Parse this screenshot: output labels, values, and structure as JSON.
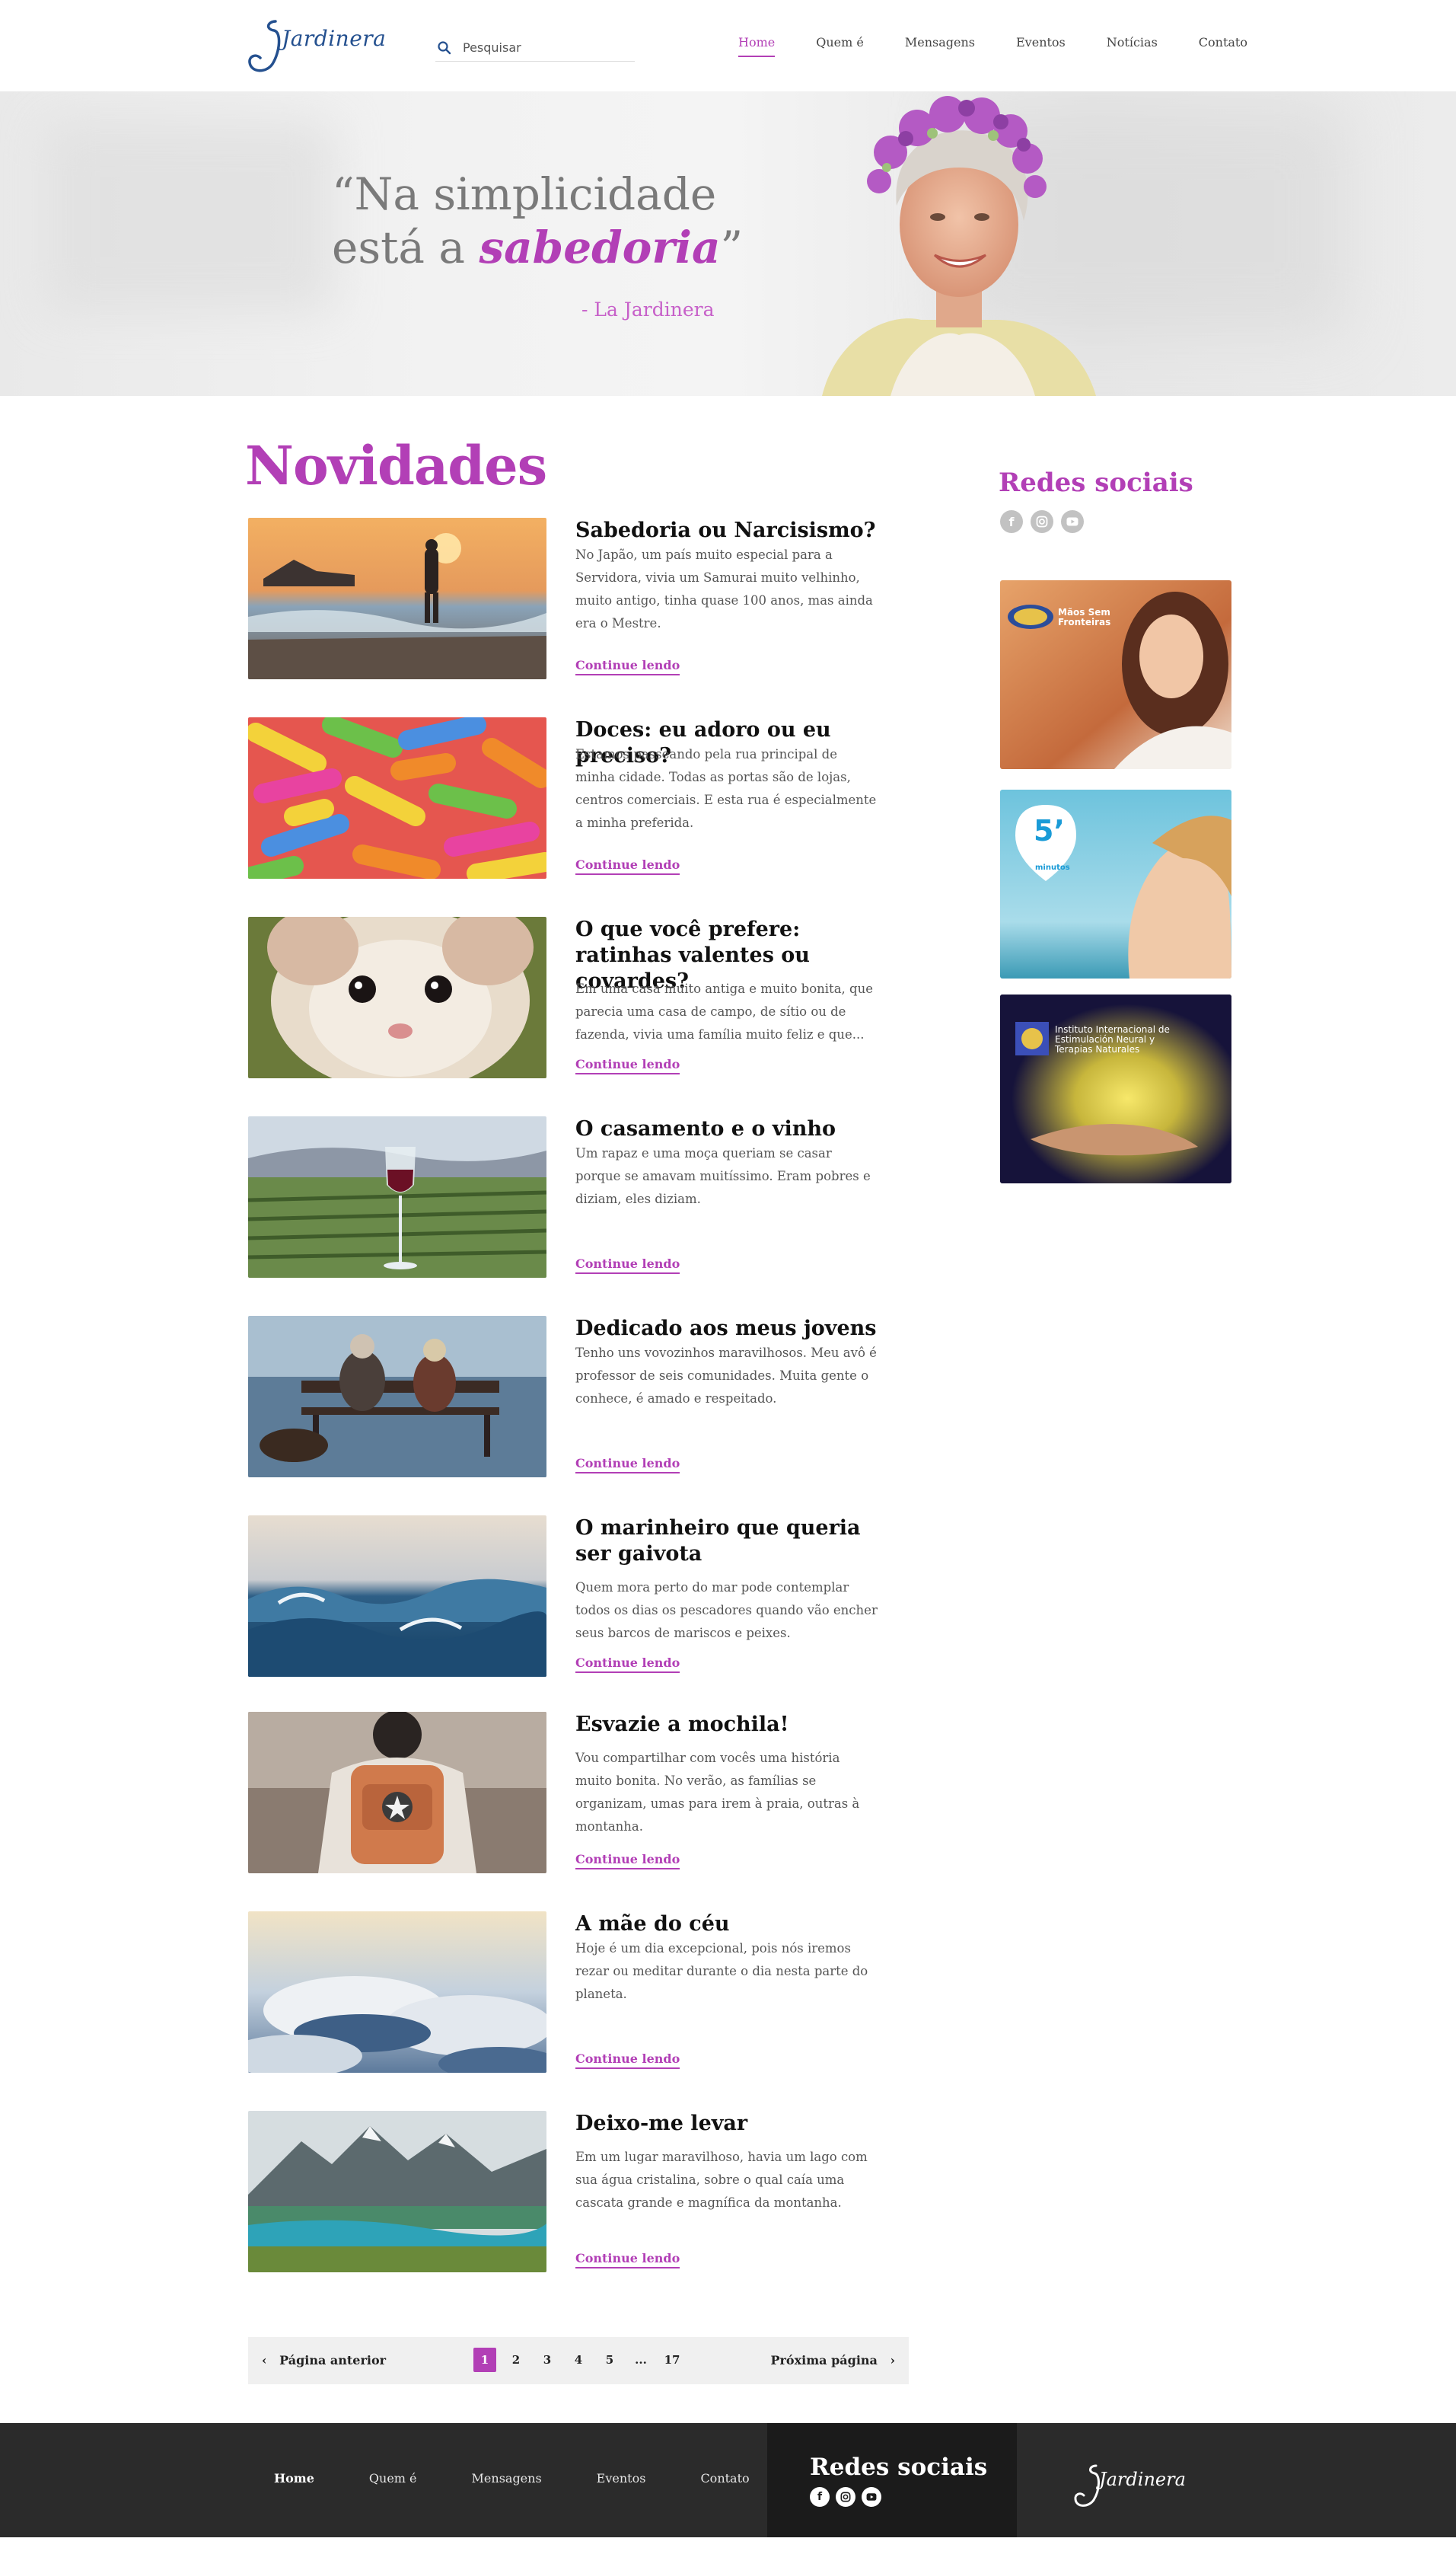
{
  "header": {
    "logo_text": "Jardinera",
    "search_placeholder": "Pesquisar",
    "nav": [
      "Home",
      "Quem é",
      "Mensagens",
      "Eventos",
      "Notícias",
      "Contato"
    ],
    "active_nav": "Home"
  },
  "hero": {
    "quote_line1": "“Na simplicidade",
    "quote_line2_prefix": "está a ",
    "quote_emphasis": "sabedoria",
    "quote_close": "”",
    "author": "- La Jardinera"
  },
  "main": {
    "title": "Novidades",
    "link_label": "Continue lendo",
    "posts": [
      {
        "title": "Sabedoria ou Narcisismo?",
        "excerpt": "No Japão, um país muito especial para a Servidora, vivia um Samurai muito velhinho, muito antigo, tinha quase 100 anos, mas ainda era o Mestre."
      },
      {
        "title": "Doces: eu adoro ou eu preciso?",
        "excerpt": "Estamos passeando pela rua principal de minha cidade. Todas as portas são de lojas, centros comerciais. E esta rua é especialmente a minha preferida."
      },
      {
        "title": "O que você prefere: ratinhas valentes ou covardes?",
        "excerpt": "Em uma casa muito antiga e muito bonita, que parecia uma casa de campo, de sítio ou de fazenda, vivia uma família muito feliz e que..."
      },
      {
        "title": "O casamento e o vinho",
        "excerpt": "Um rapaz e uma moça queriam se casar porque se amavam muitíssimo. Eram pobres e diziam, eles diziam."
      },
      {
        "title": "Dedicado aos meus jovens",
        "excerpt": "Tenho uns vovozinhos maravilhosos. Meu avô é professor de seis comunidades. Muita gente o conhece, é amado e respeitado."
      },
      {
        "title": "O marinheiro que queria ser gaivota",
        "excerpt": "Quem mora perto do mar pode contemplar todos os dias os pescadores quando vão encher seus barcos de mariscos e peixes."
      },
      {
        "title": "Esvazie a mochila!",
        "excerpt": "Vou compartilhar com vocês uma história muito bonita. No verão, as famílias se organizam, umas para irem à praia, outras à montanha."
      },
      {
        "title": "A mãe do céu",
        "excerpt": "Hoje é um dia excepcional, pois nós iremos rezar ou meditar durante o dia nesta parte do planeta."
      },
      {
        "title": "Deixo-me levar",
        "excerpt": "Em um lugar maravilhoso, havia um lago com sua água cristalina, sobre o qual caía uma cascata grande e magnífica da montanha."
      }
    ]
  },
  "sidebar": {
    "title": "Redes sociais",
    "social_icons": [
      "facebook-icon",
      "instagram-icon",
      "youtube-icon"
    ],
    "ads": [
      {
        "text": "Mãos Sem Fronteiras"
      },
      {
        "text": "5’",
        "sub": "minutos"
      },
      {
        "text": "Instituto Internacional de Estimulación Neural y Terapias Naturales"
      }
    ]
  },
  "pagination": {
    "prev": "Página anterior",
    "next": "Próxima página",
    "pages": [
      "1",
      "2",
      "3",
      "4",
      "5",
      "...",
      "17"
    ],
    "current": "1"
  },
  "footer": {
    "nav": [
      "Home",
      "Quem é",
      "Mensagens",
      "Eventos",
      "Contato"
    ],
    "social_title": "Redes sociais",
    "logo_text": "Jardinera"
  },
  "colors": {
    "accent": "#b23fb6",
    "footer_bg": "#2b2b2b",
    "footer_box": "#1b1b1b"
  }
}
